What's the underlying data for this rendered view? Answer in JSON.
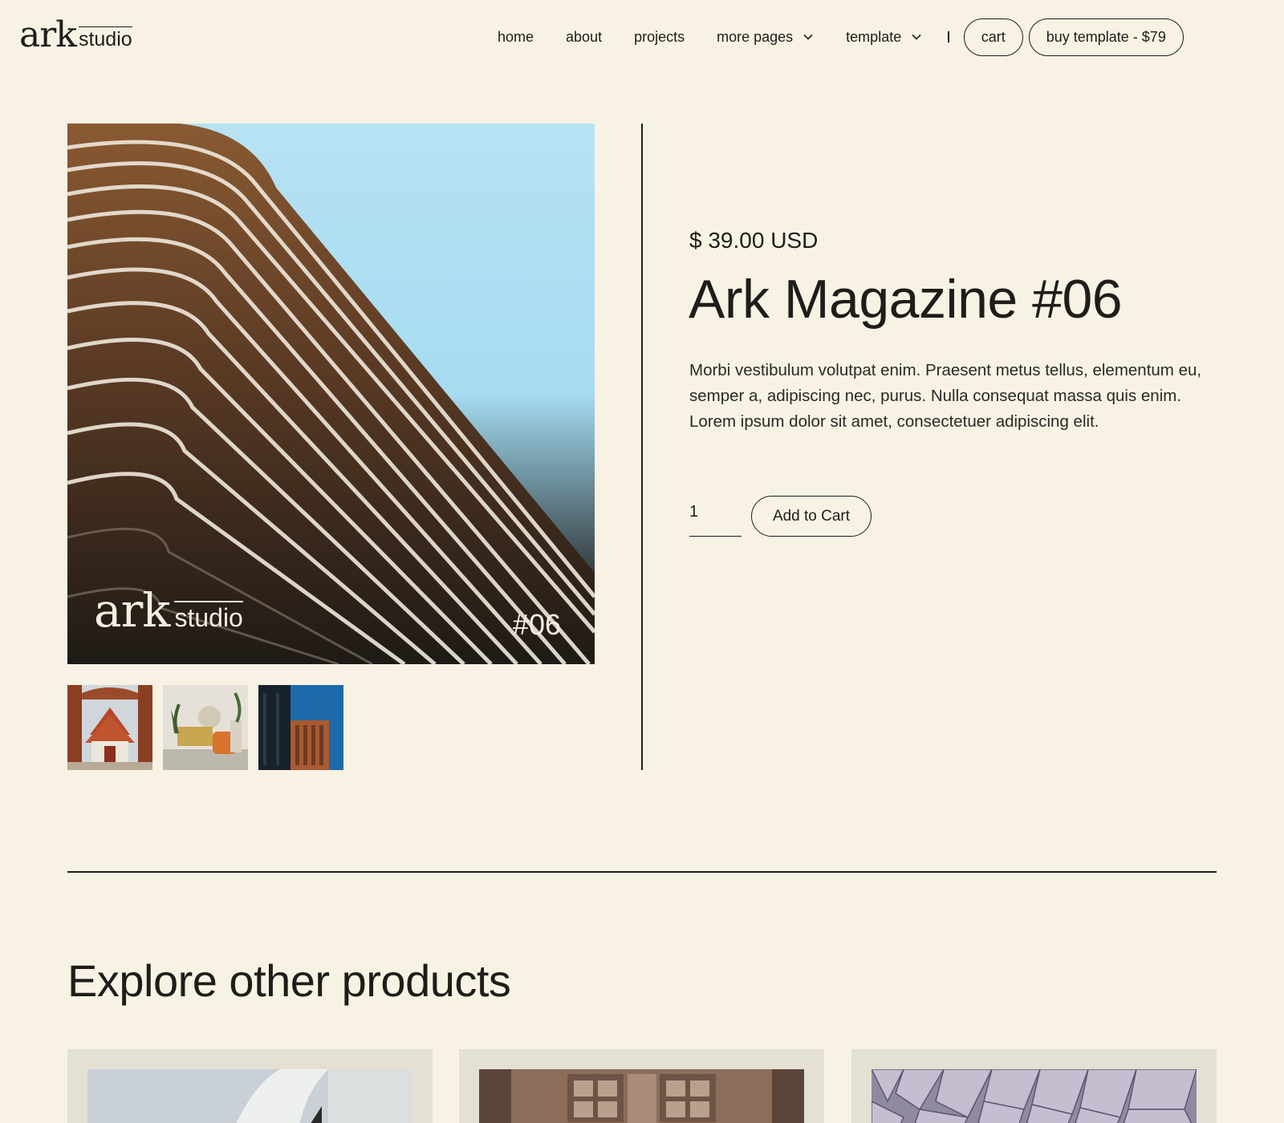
{
  "brand": {
    "logo_main": "ark",
    "logo_sub": "studio"
  },
  "nav": {
    "links": [
      "home",
      "about",
      "projects",
      "more pages",
      "template"
    ],
    "cart_label": "cart",
    "buy_label": "buy template - $79"
  },
  "product": {
    "price": "$ 39.00 USD",
    "title": "Ark Magazine #06",
    "description": "Morbi vestibulum volutpat enim. Praesent metus tellus, elementum eu, semper a, adipiscing nec, purus. Nulla consequat massa quis enim. Lorem ipsum dolor sit amet, consectetuer adipiscing elit.",
    "quantity": "1",
    "add_to_cart_label": "Add to Cart",
    "cover_logo_main": "ark",
    "cover_logo_sub": "studio",
    "cover_issue": "#06"
  },
  "thumbnails": [
    "temple-photo",
    "living-room-photo",
    "building-facade-photo"
  ],
  "explore": {
    "heading": "Explore other products",
    "cards": [
      "architecture-photo",
      "kitchen-photo",
      "metal-facade-photo"
    ]
  },
  "colors": {
    "background": "#f8f2e4",
    "text": "#1e1d1a",
    "card_bg": "#e4e0d3",
    "sky": "#a6dcf0",
    "building": "#5a3a24"
  }
}
